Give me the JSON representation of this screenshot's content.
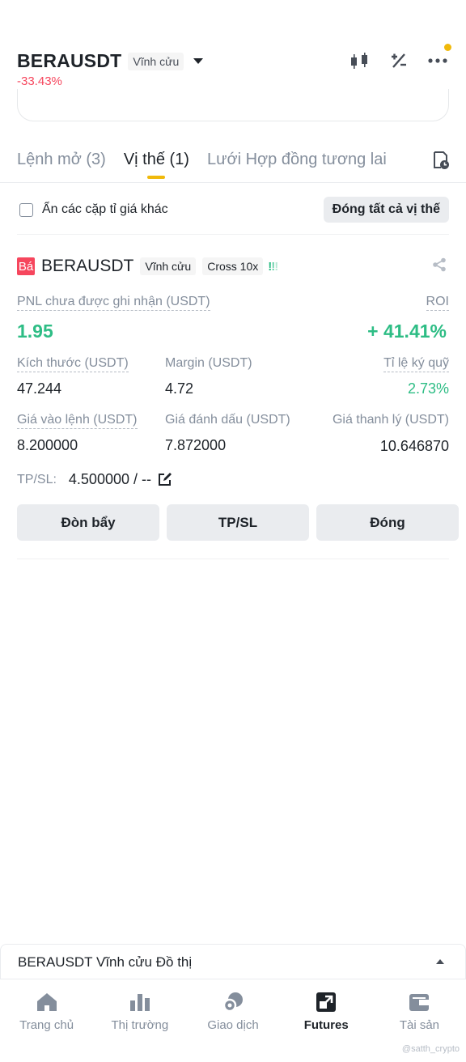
{
  "header": {
    "pair": "BERAUSDT",
    "contract_type": "Vĩnh cửu",
    "change": "-33.43%",
    "icons": [
      "candlestick-icon",
      "percent-adjust-icon",
      "more-icon"
    ],
    "notification_color": "#f0b90b"
  },
  "tabs": [
    {
      "label": "Lệnh mở (3)",
      "active": false
    },
    {
      "label": "Vị thế (1)",
      "active": true
    },
    {
      "label": "Lưới Hợp đồng tương lai",
      "active": false
    }
  ],
  "filter": {
    "hide_other_pairs": "Ẩn các cặp tỉ giá khác",
    "hide_checked": false,
    "close_all": "Đóng tất cả vị thế"
  },
  "position": {
    "side": "Bá",
    "symbol": "BERAUSDT",
    "contract_type": "Vĩnh cửu",
    "margin_mode": "Cross 10x",
    "risk": [
      "!",
      "!",
      "!"
    ],
    "pnl_label": "PNL chưa được ghi nhận (USDT)",
    "pnl_value": "1.95",
    "roi_label": "ROI",
    "roi_value": "+ 41.41%",
    "size_label": "Kích thước (USDT)",
    "size_value": "47.244",
    "margin_label": "Margin (USDT)",
    "margin_value": "4.72",
    "margin_ratio_label": "Tỉ lệ ký quỹ",
    "margin_ratio_value": "2.73%",
    "entry_label": "Giá vào lệnh (USDT)",
    "entry_value": "8.200000",
    "mark_label": "Giá đánh dấu (USDT)",
    "mark_value": "7.872000",
    "liq_label": "Giá thanh lý (USDT)",
    "liq_value": "10.646870",
    "tpsl_label": "TP/SL:",
    "tpsl_value": "4.500000 / --",
    "buttons": {
      "leverage": "Đòn bẩy",
      "tpsl": "TP/SL",
      "close": "Đóng"
    }
  },
  "chart_bar": {
    "label": "BERAUSDT Vĩnh cửu Đồ thị"
  },
  "bottom_nav": [
    {
      "label": "Trang chủ",
      "icon": "home-icon",
      "active": false
    },
    {
      "label": "Thị trường",
      "icon": "market-icon",
      "active": false
    },
    {
      "label": "Giao dịch",
      "icon": "trade-icon",
      "active": false
    },
    {
      "label": "Futures",
      "icon": "futures-icon",
      "active": true
    },
    {
      "label": "Tài sản",
      "icon": "wallet-icon",
      "active": false
    }
  ],
  "watermark": "@satth_crypto",
  "colors": {
    "accent": "#f0b90b",
    "up": "#2ebd85",
    "down": "#f6465d"
  }
}
